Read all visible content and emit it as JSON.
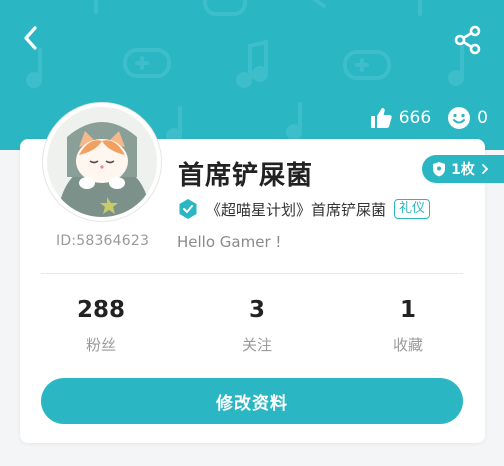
{
  "colors": {
    "accent": "#2bb6c3",
    "header_bg": "#2bb6c3"
  },
  "header": {
    "back_icon": "chevron-left-icon",
    "share_icon": "share-icon",
    "likes": {
      "icon": "thumbs-up-icon",
      "count": "666"
    },
    "smiles": {
      "icon": "smiley-icon",
      "count": "0"
    }
  },
  "profile": {
    "nickname": "首席铲屎菌",
    "user_id": "ID:58364623",
    "badge": {
      "icon": "shield-badge-icon",
      "label": "1枚"
    },
    "verification": {
      "icon": "verified-icon",
      "text": "《超喵星计划》首席铲屎菌",
      "tag": "礼仪"
    },
    "bio": "Hello Gamer !"
  },
  "counts": [
    {
      "value": "288",
      "label": "粉丝"
    },
    {
      "value": "3",
      "label": "关注"
    },
    {
      "value": "1",
      "label": "收藏"
    }
  ],
  "actions": {
    "edit_profile": "修改资料"
  }
}
